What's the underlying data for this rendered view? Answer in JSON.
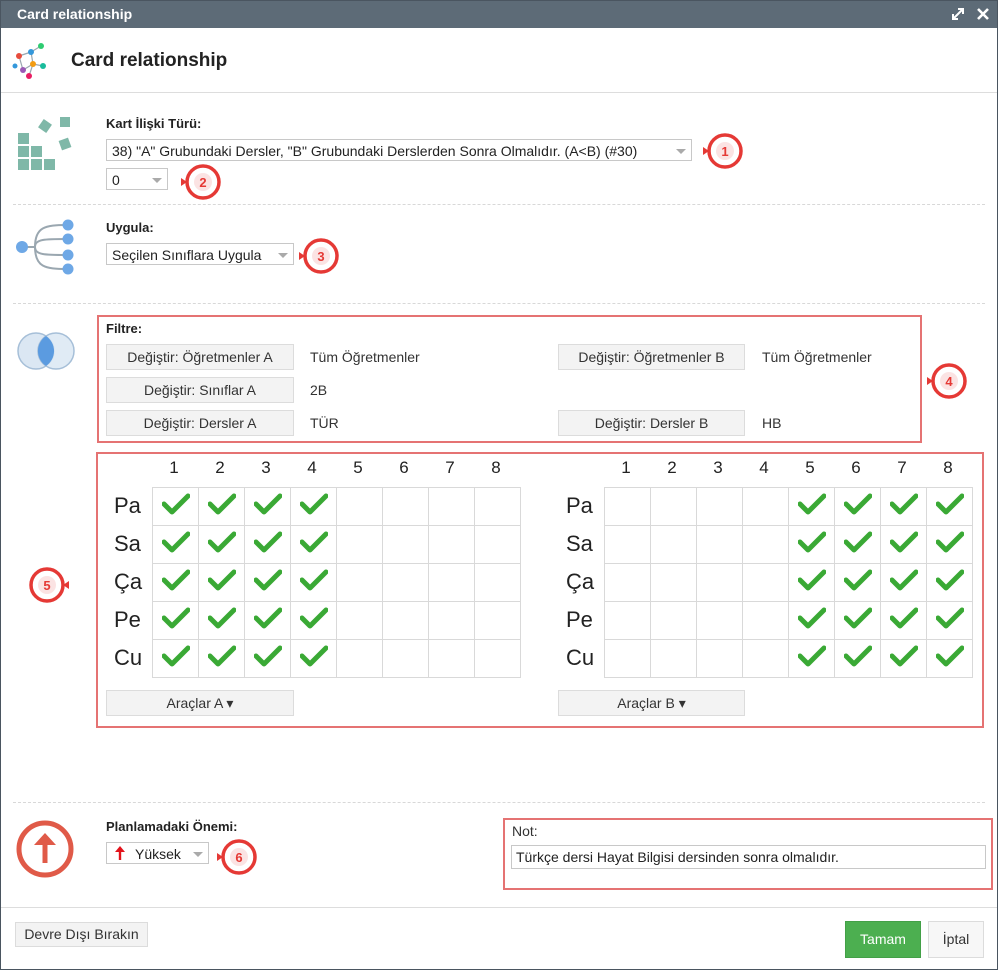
{
  "window": {
    "title": "Card relationship"
  },
  "header": {
    "title": "Card relationship"
  },
  "relation": {
    "label": "Kart İlişki Türü:",
    "type_value": "38) \"A\" Grubundaki Dersler, \"B\" Grubundaki Derslerden Sonra Olmalıdır. (A<B) (#30)",
    "param_value": "0"
  },
  "apply": {
    "label": "Uygula:",
    "value": "Seçilen Sınıflara Uygula"
  },
  "filter": {
    "label": "Filtre:",
    "teachers_a_button": "Değiştir: Öğretmenler A",
    "teachers_a_value": "Tüm Öğretmenler",
    "teachers_b_button": "Değiştir: Öğretmenler B",
    "teachers_b_value": "Tüm Öğretmenler",
    "classes_a_button": "Değiştir: Sınıflar A",
    "classes_a_value": "2B",
    "subjects_a_button": "Değiştir: Dersler A",
    "subjects_a_value": "TÜR",
    "subjects_b_button": "Değiştir: Dersler B",
    "subjects_b_value": "HB"
  },
  "grid": {
    "columns": [
      "1",
      "2",
      "3",
      "4",
      "5",
      "6",
      "7",
      "8"
    ],
    "rows": [
      "Pa",
      "Sa",
      "Ça",
      "Pe",
      "Cu"
    ],
    "a_checked_periods": [
      1,
      2,
      3,
      4
    ],
    "b_checked_periods": [
      5,
      6,
      7,
      8
    ],
    "tools_a": "Araçlar A ▾",
    "tools_b": "Araçlar B ▾"
  },
  "importance": {
    "label": "Planlamadaki Önemi:",
    "value": "Yüksek"
  },
  "note": {
    "label": "Not:",
    "value": "Türkçe dersi Hayat Bilgisi dersinden sonra olmalıdır."
  },
  "callouts": [
    "1",
    "2",
    "3",
    "4",
    "5",
    "6"
  ],
  "footer": {
    "disable_button": "Devre Dışı Bırakın",
    "ok_button": "Tamam",
    "cancel_button": "İptal"
  },
  "colors": {
    "titlebar": "#5d6b77",
    "check": "#3aa935",
    "callout": "#e53935",
    "ok": "#4caf50"
  },
  "icons": [
    "maximize-icon",
    "close-icon",
    "network-icon",
    "tiles-icon",
    "tree-icon",
    "venn-icon",
    "arrow-up-circle-icon",
    "red-arrow-up-icon",
    "checkmark-icon"
  ]
}
